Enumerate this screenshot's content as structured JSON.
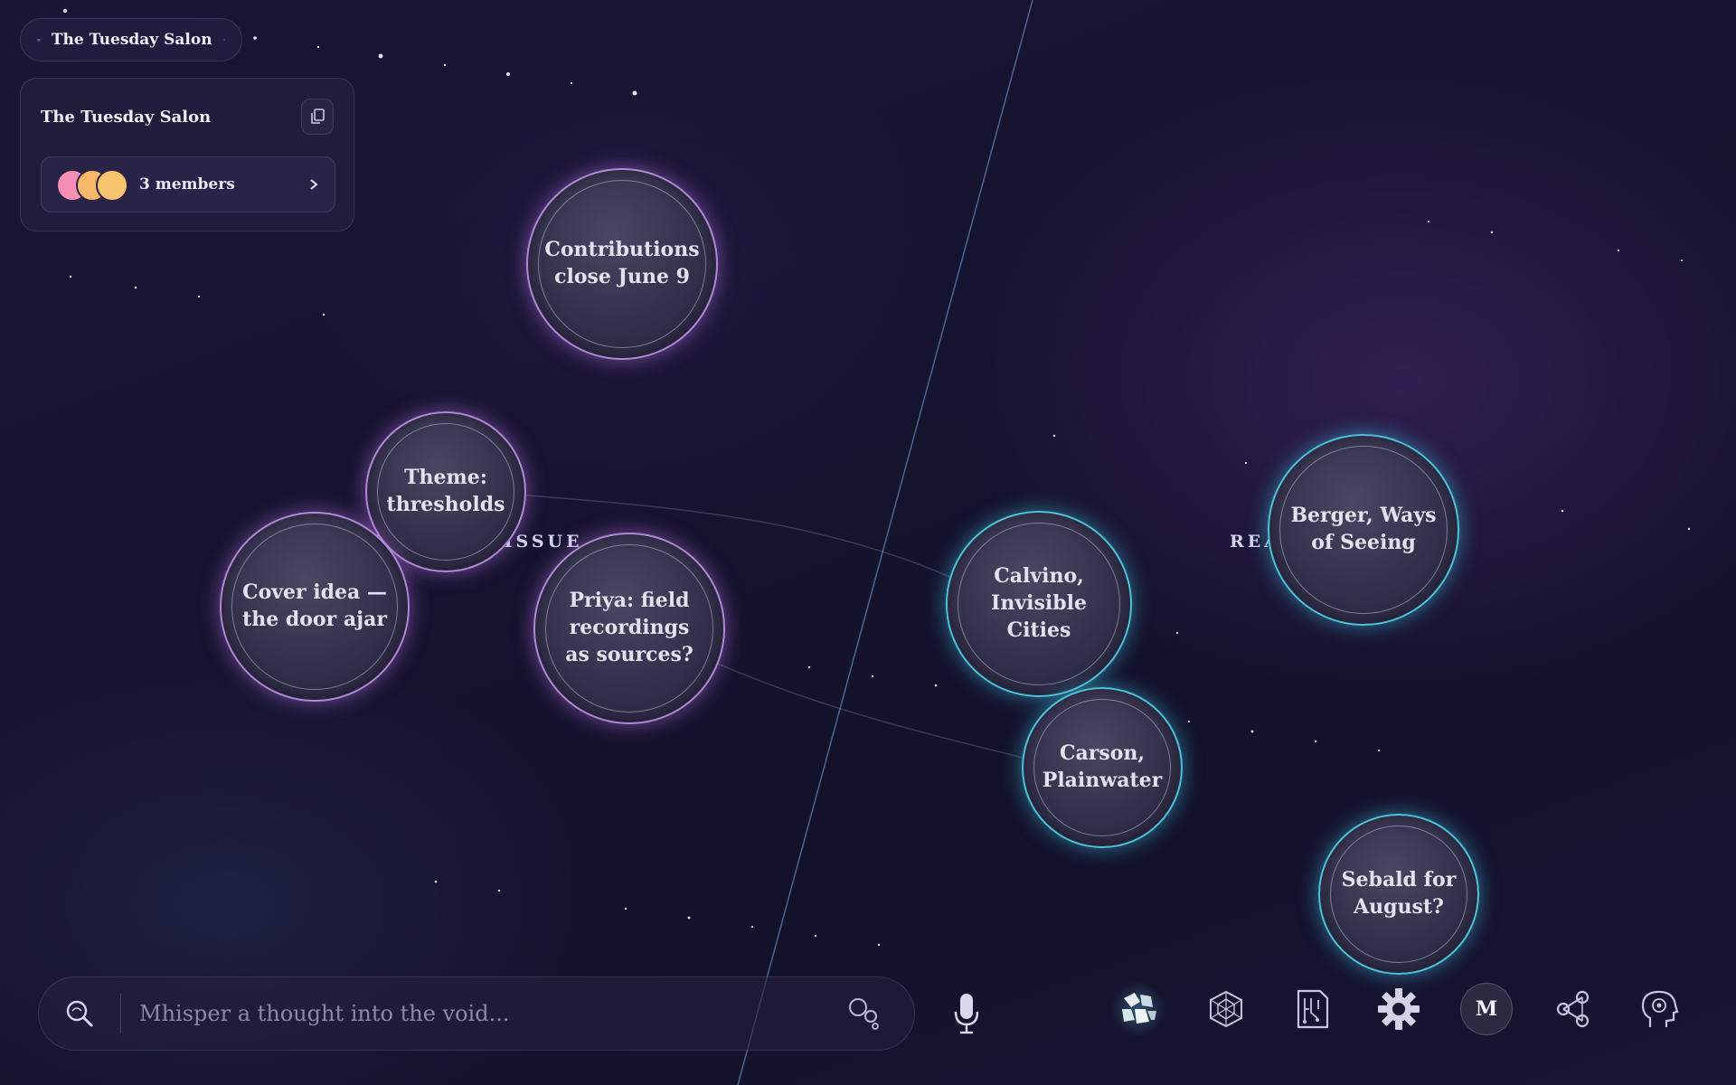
{
  "group": {
    "name": "The Tuesday Salon",
    "panel_title": "The Tuesday Salon",
    "members_label": "3 members",
    "avatar_colors": [
      "#f590b4",
      "#f7b86a",
      "#f9c46e"
    ]
  },
  "clusters": [
    {
      "label": "SPRING ISSUE",
      "visible_text": "T SPRING ISSUE"
    },
    {
      "label": "READING",
      "visible_text": "READI"
    }
  ],
  "thoughts": {
    "contributions": "Contributions close June 9",
    "theme": "Theme: thresholds",
    "cover": "Cover idea — the door ajar",
    "priya": "Priya: field recordings as sources?",
    "calvino": "Calvino, Invisible Cities",
    "carson": "Carson, Plainwater",
    "berger": "Berger, Ways of Seeing",
    "sebald": "Sebald for August?"
  },
  "search": {
    "placeholder": "Mhisper a thought into the void..."
  },
  "dock": {
    "icons": [
      "clusters-icon",
      "network-icon",
      "circuit-icon",
      "settings-icon",
      "profile-m",
      "share-icon",
      "mind-icon"
    ],
    "profile_initial": "M"
  },
  "colors": {
    "purple_glow": "#c896f0",
    "teal_glow": "#50d2eb",
    "background": "#16132e"
  }
}
